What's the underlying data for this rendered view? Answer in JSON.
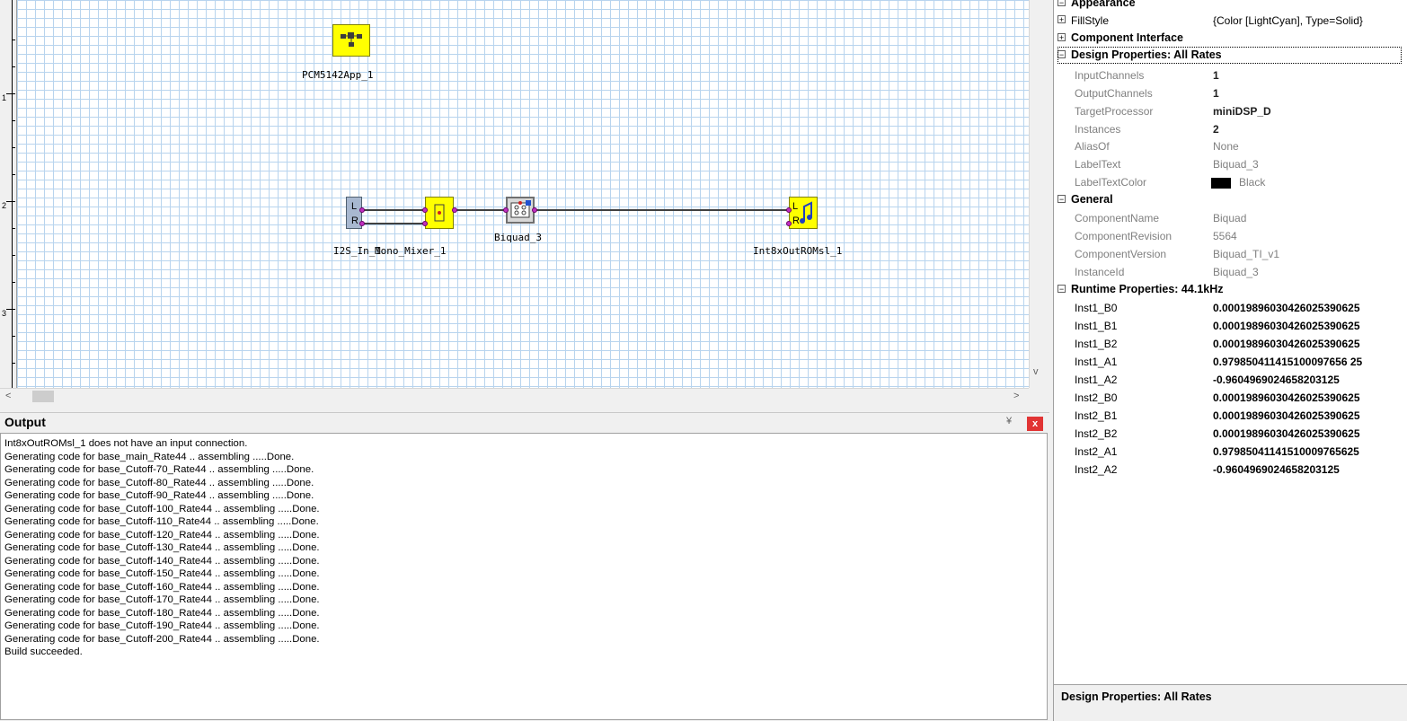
{
  "ruler": {
    "labels": [
      "1",
      "2",
      "3"
    ]
  },
  "canvas": {
    "components": {
      "pcm_app": {
        "label": "PCM5142App_1"
      },
      "i2s_in": {
        "label": "I2S_In_1",
        "pins": [
          "L",
          "R"
        ]
      },
      "mono_mixer": {
        "label": "Mono_Mixer_1"
      },
      "biquad": {
        "label": "Biquad_3"
      },
      "int8x_out": {
        "label": "Int8xOutROMsl_1",
        "pins": [
          "L",
          "R"
        ]
      }
    }
  },
  "scroll": {
    "left_arrow": "<",
    "right_arrow": ">",
    "down_arrow": "v"
  },
  "output": {
    "title": "Output",
    "close": "x",
    "pin": "¥",
    "lines": [
      "Int8xOutROMsl_1 does not have an input connection.",
      "Generating code for base_main_Rate44 ..  assembling .....Done.",
      "Generating code for base_Cutoff-70_Rate44 ..  assembling .....Done.",
      "Generating code for base_Cutoff-80_Rate44 ..  assembling .....Done.",
      "Generating code for base_Cutoff-90_Rate44 ..  assembling .....Done.",
      "Generating code for base_Cutoff-100_Rate44 ..  assembling .....Done.",
      "Generating code for base_Cutoff-110_Rate44 ..  assembling .....Done.",
      "Generating code for base_Cutoff-120_Rate44 ..  assembling .....Done.",
      "Generating code for base_Cutoff-130_Rate44 ..  assembling .....Done.",
      "Generating code for base_Cutoff-140_Rate44 ..  assembling .....Done.",
      "Generating code for base_Cutoff-150_Rate44 ..  assembling .....Done.",
      "Generating code for base_Cutoff-160_Rate44 ..  assembling .....Done.",
      "Generating code for base_Cutoff-170_Rate44 ..  assembling .....Done.",
      "Generating code for base_Cutoff-180_Rate44 ..  assembling .....Done.",
      "Generating code for base_Cutoff-190_Rate44 ..  assembling .....Done.",
      "Generating code for base_Cutoff-200_Rate44 ..  assembling .....Done.",
      "Build succeeded."
    ]
  },
  "properties": {
    "appearance": {
      "label": "Appearance",
      "fillstyle_name": "FillStyle",
      "fillstyle_value": "{Color [LightCyan], Type=Solid}"
    },
    "component_interface": {
      "label": "Component Interface"
    },
    "design": {
      "label": "Design Properties: All Rates",
      "rows": [
        {
          "name": "InputChannels",
          "value": "1"
        },
        {
          "name": "OutputChannels",
          "value": "1"
        },
        {
          "name": "TargetProcessor",
          "value": "miniDSP_D"
        },
        {
          "name": "Instances",
          "value": "2"
        },
        {
          "name": "AliasOf",
          "value": "None"
        },
        {
          "name": "LabelText",
          "value": "Biquad_3"
        },
        {
          "name": "LabelTextColor",
          "value": "Black"
        }
      ],
      "label_text_color_swatch": "#000000"
    },
    "general": {
      "label": "General",
      "rows": [
        {
          "name": "ComponentName",
          "value": "Biquad"
        },
        {
          "name": "ComponentRevision",
          "value": "5564"
        },
        {
          "name": "ComponentVersion",
          "value": "Biquad_TI_v1"
        },
        {
          "name": "InstanceId",
          "value": "Biquad_3"
        }
      ]
    },
    "runtime": {
      "label": "Runtime Properties: 44.1kHz",
      "rows": [
        {
          "name": "Inst1_B0",
          "value": "0.00019896030426025390625"
        },
        {
          "name": "Inst1_B1",
          "value": "0.00019896030426025390625"
        },
        {
          "name": "Inst1_B2",
          "value": "0.00019896030426025390625"
        },
        {
          "name": "Inst1_A1",
          "value": "0.979850411415100097656 25"
        },
        {
          "name": "Inst1_A2",
          "value": "-0.9604969024658203125"
        },
        {
          "name": "Inst2_B0",
          "value": "0.00019896030426025390625"
        },
        {
          "name": "Inst2_B1",
          "value": "0.00019896030426025390625"
        },
        {
          "name": "Inst2_B2",
          "value": "0.00019896030426025390625"
        },
        {
          "name": "Inst2_A1",
          "value": "0.97985041141510009765625"
        },
        {
          "name": "Inst2_A2",
          "value": "-0.9604969024658203125"
        }
      ]
    },
    "description": {
      "title": "Design Properties: All Rates"
    }
  },
  "colors": {
    "component_yellow": "#ffff00",
    "i2s_block": "#a8b8d0",
    "grid_line": "#b8d4ee",
    "pin": "#c030c0",
    "close_red": "#e13434"
  }
}
